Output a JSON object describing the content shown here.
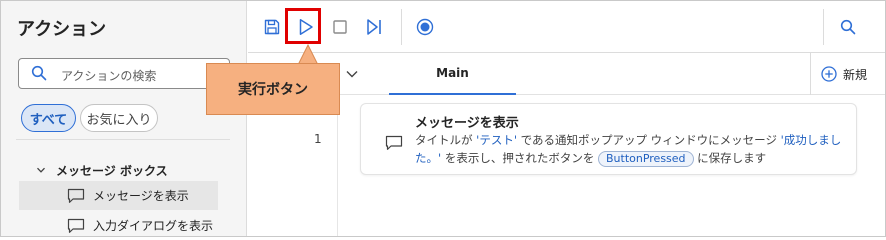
{
  "actions_pane": {
    "title": "アクション",
    "search_placeholder": "アクションの検索",
    "filters": {
      "all": "すべて",
      "favorites": "お気に入り"
    },
    "group_label": "メッセージ ボックス",
    "items": [
      {
        "label": "メッセージを表示"
      },
      {
        "label": "入力ダイアログを表示"
      }
    ]
  },
  "toolbar": {
    "icons": [
      "save-icon",
      "run-icon",
      "stop-icon",
      "run-next-action-icon",
      "recorder-icon",
      "search-icon"
    ],
    "accent": "#2f6fd6"
  },
  "tabs": {
    "main_label": "Main",
    "new_label": "新規"
  },
  "flow": {
    "line_number": "1",
    "action": {
      "title": "メッセージを表示",
      "desc_prefix": "タイトルが ",
      "title_value": "'テスト'",
      "desc_middle": " である通知ポップアップ ウィンドウにメッセージ ",
      "message_value": "'成功しました。'",
      "desc_suffix": " を表示し、押されたボタンを ",
      "variable": "ButtonPressed",
      "desc_end": " に保存します"
    }
  },
  "callout": {
    "text": "実行ボタン",
    "fill": "#f6b080",
    "highlight_color": "#e00000"
  }
}
